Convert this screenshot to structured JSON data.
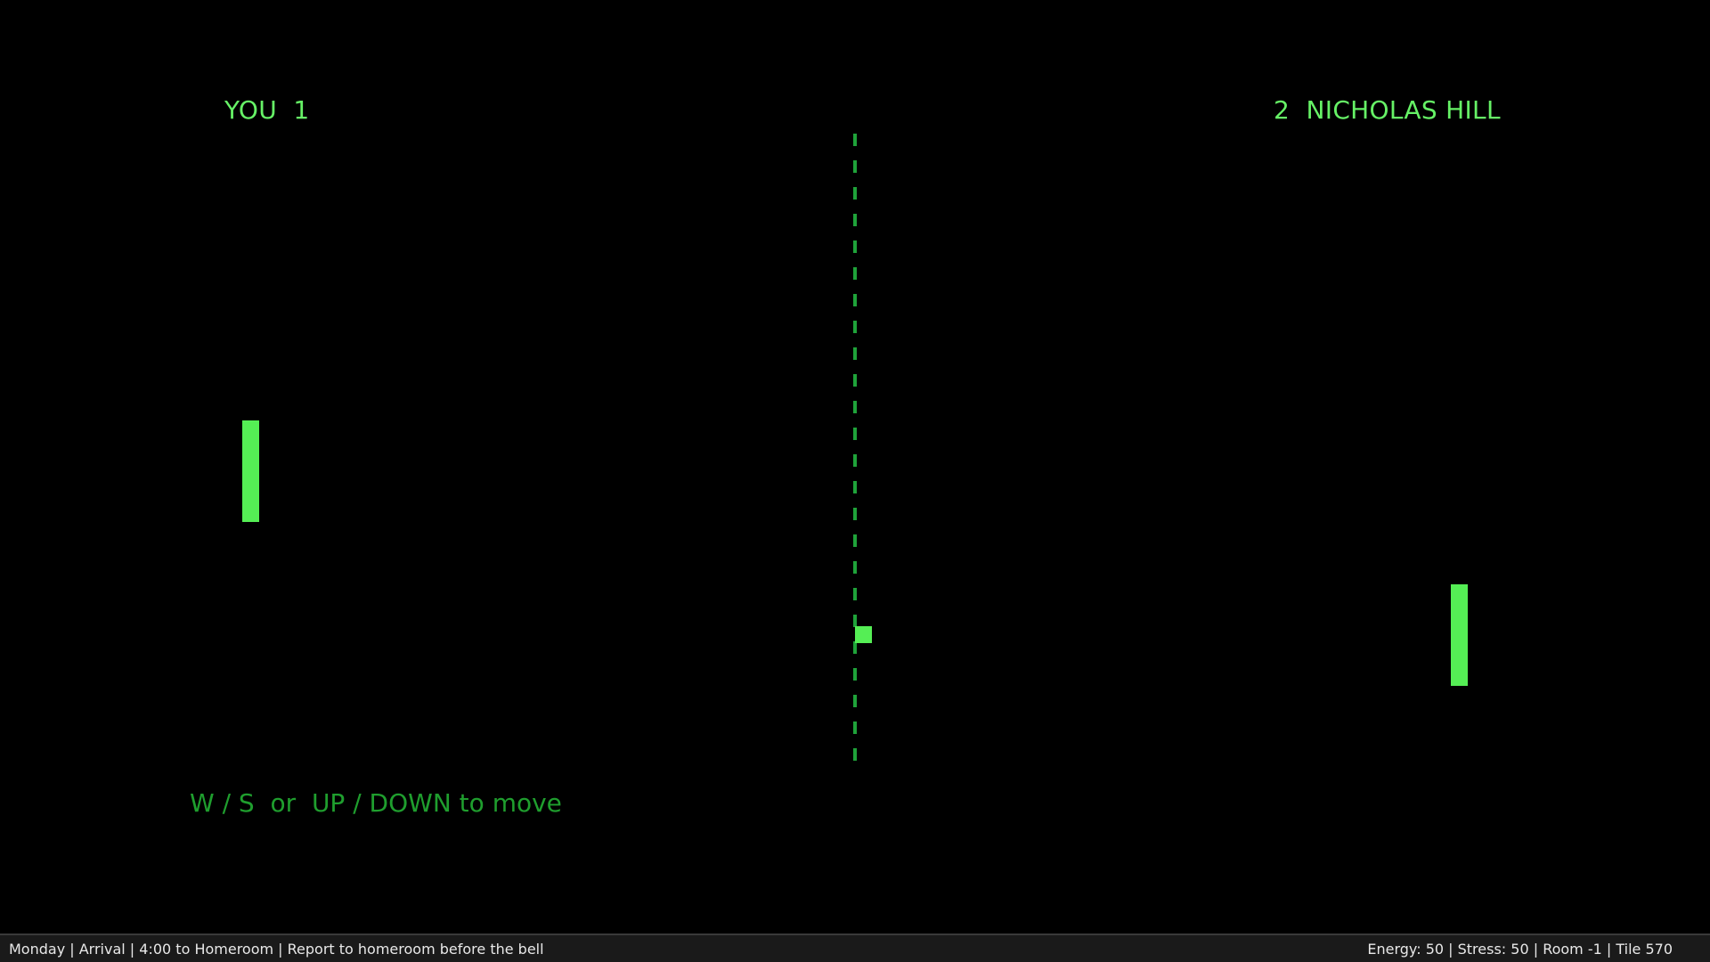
{
  "scoreboard": {
    "left_text": "YOU  1",
    "right_text": "2  NICHOLAS HILL",
    "player_name": "YOU",
    "player_score": 1,
    "opponent_name": "NICHOLAS HILL",
    "opponent_score": 2
  },
  "hint": {
    "text": "W / S  or  UP / DOWN to move"
  },
  "status_bar": {
    "left": "Monday | Arrival | 4:00 to Homeroom | Report to homeroom before the bell",
    "right": "Energy: 50 | Stress: 50 | Room -1 | Tile 570"
  },
  "colors": {
    "background": "#000000",
    "paddle_and_ball": "#55ee55",
    "score_text": "#66f266",
    "hint_text": "#1f9e2e",
    "net": "#1fa33a",
    "status_bar_bg": "#1a1a1a",
    "status_bar_text": "#e8e8e8"
  }
}
